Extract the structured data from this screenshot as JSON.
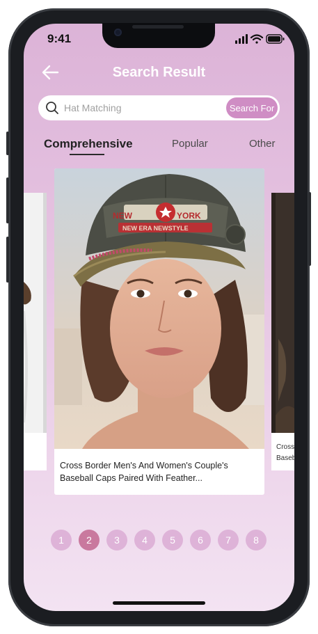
{
  "status_bar": {
    "time": "9:41"
  },
  "header": {
    "title": "Search Result"
  },
  "search": {
    "placeholder": "Hat Matching",
    "button_label": "Search For"
  },
  "tabs": [
    {
      "label": "Comprehensive",
      "active": true
    },
    {
      "label": "Popular",
      "active": false
    },
    {
      "label": "Other",
      "active": false
    }
  ],
  "cards": {
    "main": {
      "title": "Cross Border Men's And Women's Couple's Baseball Caps Paired With Feather..."
    },
    "right_partial": {
      "line1": "Cross",
      "line2": "Baseb"
    }
  },
  "cap_patch": {
    "line1": "NEW",
    "line2": "YORK",
    "line3": "NEW ERA NEWSTYLE"
  },
  "pagination": {
    "pages": [
      "1",
      "2",
      "3",
      "4",
      "5",
      "6",
      "7",
      "8"
    ],
    "current": "2"
  },
  "colors": {
    "accent": "#cf8dc4",
    "page_dot": "#deb3d8",
    "page_dot_active": "#c9799e",
    "background_top": "#dcb3d7",
    "background_bottom": "#f3e3f2"
  }
}
